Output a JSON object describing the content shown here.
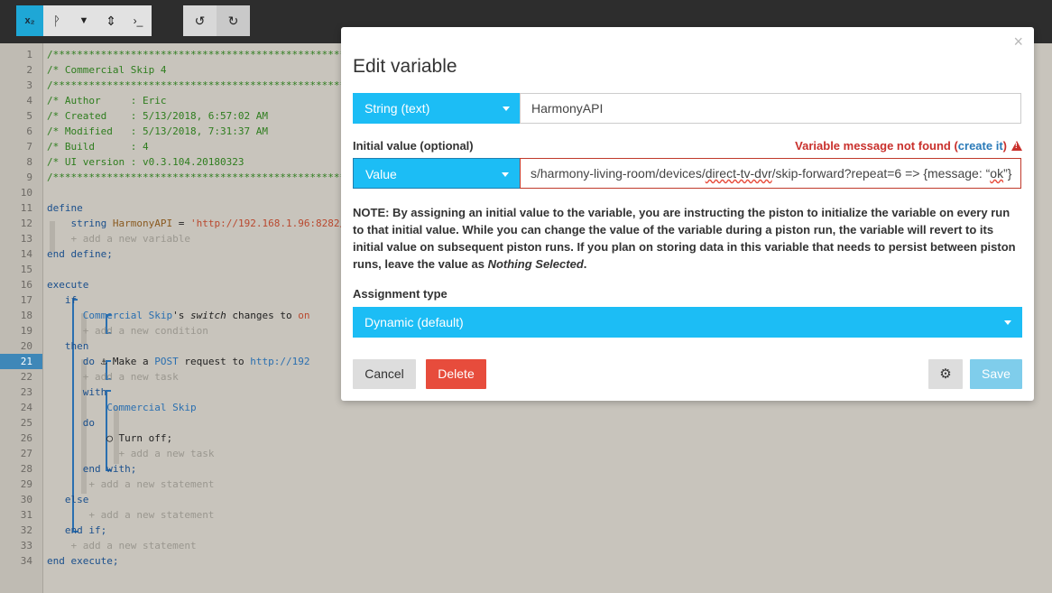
{
  "toolbar": {
    "buttons": [
      {
        "id": "variables",
        "glyph": "x₂"
      },
      {
        "id": "branch",
        "glyph": "ᚹ"
      },
      {
        "id": "filter",
        "glyph": "▼"
      },
      {
        "id": "sort",
        "glyph": "⇕"
      },
      {
        "id": "terminal",
        "glyph": "›_"
      },
      {
        "id": "undo",
        "glyph": "↺"
      },
      {
        "id": "redo",
        "glyph": "↻"
      }
    ]
  },
  "editor": {
    "line_numbers": [
      "1",
      "2",
      "3",
      "4",
      "5",
      "6",
      "7",
      "8",
      "9",
      "10",
      "11",
      "12",
      "13",
      "14",
      "15",
      "16",
      "17",
      "18",
      "19",
      "20",
      "21",
      "22",
      "23",
      "24",
      "25",
      "26",
      "27",
      "28",
      "29",
      "30",
      "31",
      "32",
      "33",
      "34"
    ],
    "highlighted_line": "21",
    "code": {
      "l1": "/*************************************************************",
      "l2": "/* Commercial Skip 4",
      "l3": "/*************************************************************",
      "l4": "/* Author     : Eric",
      "l5": "/* Created    : 5/13/2018, 6:57:02 AM",
      "l6": "/* Modified   : 5/13/2018, 7:31:37 AM",
      "l7": "/* Build      : 4",
      "l8": "/* UI version : v0.3.104.20180323",
      "l9": "/*************************************************************",
      "l11": "define",
      "l12_type": "string",
      "l12_name": "HarmonyAPI",
      "l12_eq": "=",
      "l12_value": "'http://192.168.1.96:8282/",
      "l13": "+ add a new variable",
      "l14": "end define;",
      "l16": "execute",
      "l17": "if",
      "l18_device": "Commercial Skip",
      "l18_apos": "'s",
      "l18_attr": "switch",
      "l18_rest": "changes to",
      "l18_on": "on",
      "l19": "+ add a new condition",
      "l20": "then",
      "l21_do": "do",
      "l21_icon": "⚓",
      "l21_text": "Make a",
      "l21_method": "POST",
      "l21_text2": "request to",
      "l21_url": "http://192",
      "l22": "+ add a new task",
      "l23": "with",
      "l24": "Commercial Skip",
      "l25": "do",
      "l26": "Turn off;",
      "l27": "+ add a new task",
      "l28": "end with;",
      "l29": "+ add a new statement",
      "l30": "else",
      "l31": "+ add a new statement",
      "l32": "end if;",
      "l33": "+ add a new statement",
      "l34": "end execute;"
    }
  },
  "modal": {
    "title": "Edit variable",
    "type_select": "String (text)",
    "name_value": "HarmonyAPI",
    "initial_label": "Initial value (optional)",
    "error_text": "Variable message not found (",
    "error_link": "create it",
    "error_close": ")",
    "value_select": "Value",
    "initial_value_a": "s/harmony-living-room/devices/",
    "initial_value_b": "direct-tv-dvr",
    "initial_value_c": "/skip-forward?repeat=6 => {message: “",
    "initial_value_d": "ok",
    "initial_value_e": "”}",
    "note_main": "NOTE: By assigning an initial value to the variable, you are instructing the piston to initialize the variable on every run to that initial value. While you can change the value of the variable during a piston run, the variable will revert to its initial value on subsequent piston runs. If you plan on storing data in this variable that needs to persist between piston runs, leave the value as ",
    "note_em": "Nothing Selected",
    "note_end": ".",
    "assignment_label": "Assignment type",
    "assignment_select": "Dynamic (default)",
    "cancel_label": "Cancel",
    "delete_label": "Delete",
    "save_label": "Save",
    "close_glyph": "×",
    "gear_glyph": "⚙"
  },
  "colors": {
    "accent": "#1cbdf5",
    "danger": "#e74c3c",
    "error_text": "#c9302c",
    "toolbar_active": "#1ea7d6"
  }
}
